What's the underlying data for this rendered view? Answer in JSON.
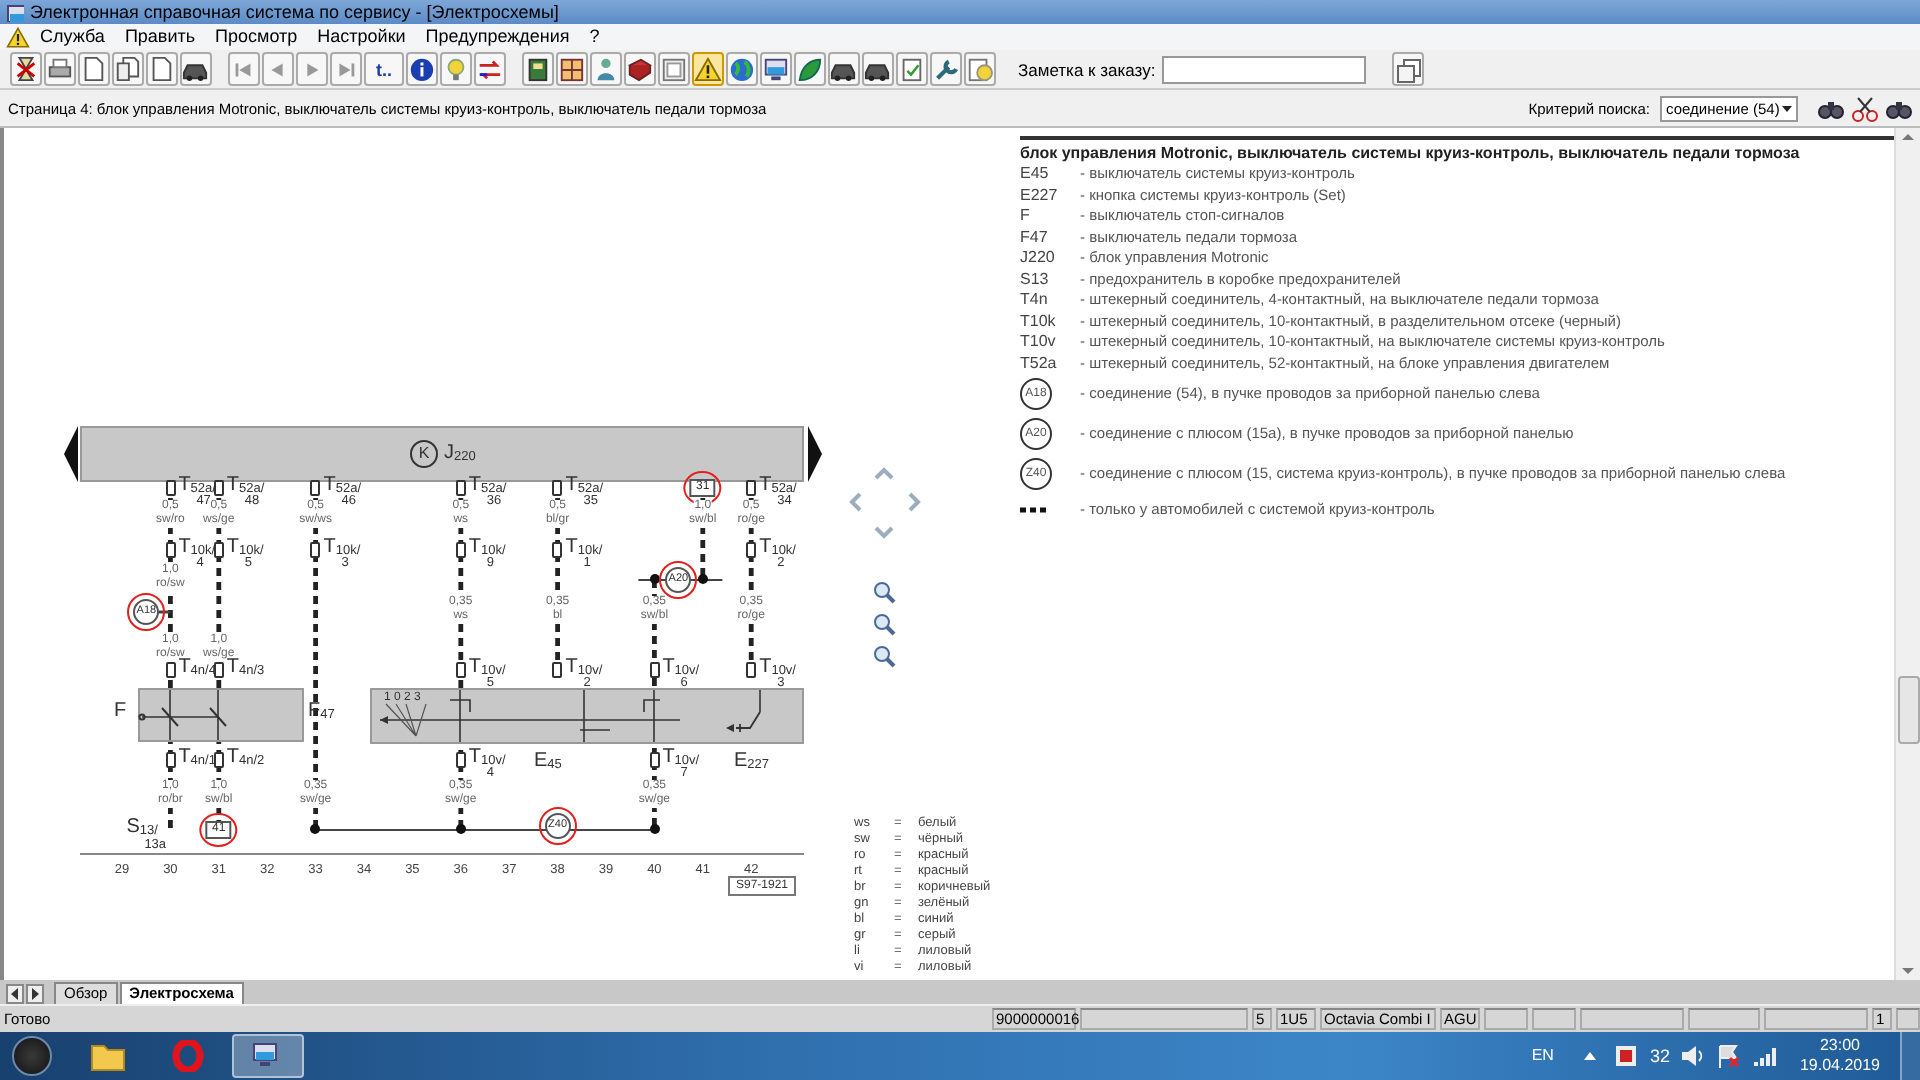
{
  "window": {
    "title": "Электронная справочная система по сервису - [Электросхемы]"
  },
  "menu": [
    "Служба",
    "Править",
    "Просмотр",
    "Настройки",
    "Предупреждения",
    "?"
  ],
  "toolbar": {
    "text_button": "t..",
    "note_label": "Заметка к заказу:"
  },
  "page_bar": {
    "title": "Страница 4: блок управления Motronic, выключатель системы круиз-контроль, выключатель педали тормоза",
    "search_label": "Критерий поиска:",
    "search_value": "соединение (54)"
  },
  "diagram": {
    "control_unit": {
      "symbol": "K",
      "label": "J$_{220}$"
    },
    "columns": [
      "29",
      "30",
      "31",
      "32",
      "33",
      "34",
      "35",
      "36",
      "37",
      "38",
      "39",
      "40",
      "41",
      "42"
    ],
    "drawing_number": "S97-1921",
    "wires": [
      {
        "items": [
          {
            "kind": "connector",
            "label": "T$_{52a/}$",
            "pin": "47"
          },
          {
            "kind": "gauge",
            "size": "0,5",
            "insulation": "sw/ro"
          },
          {
            "kind": "connector",
            "label": "T$_{10k/}$",
            "pin": "4"
          },
          {
            "kind": "gauge",
            "size": "1,0",
            "insulation": "ro/sw"
          },
          {
            "kind": "gauge",
            "size": "1,0",
            "insulation": "ro/sw"
          },
          {
            "kind": "connector",
            "label": "T$_{4n/4}$"
          },
          {
            "kind": "connector",
            "label": "T$_{4n/1}$"
          },
          {
            "kind": "gauge",
            "size": "1,0",
            "insulation": "ro/br"
          },
          {
            "kind": "fuse",
            "label": "S$_{13/}$",
            "pin": "13a"
          }
        ]
      },
      {
        "items": [
          {
            "kind": "connector",
            "label": "T$_{52a/}$",
            "pin": "48"
          },
          {
            "kind": "gauge",
            "size": "0,5",
            "insulation": "ws/ge"
          },
          {
            "kind": "connector",
            "label": "T$_{10k/}$",
            "pin": "5"
          },
          {
            "kind": "gauge",
            "size": "1,0",
            "insulation": "ws/ge"
          },
          {
            "kind": "connector",
            "label": "T$_{4n/3}$"
          },
          {
            "kind": "connector",
            "label": "T$_{4n/2}$"
          },
          {
            "kind": "gauge",
            "size": "1,0",
            "insulation": "sw/bl"
          },
          {
            "kind": "terminal",
            "label": "41",
            "highlighted": true
          }
        ]
      },
      {
        "items": [
          {
            "kind": "connector",
            "label": "T$_{52a/}$",
            "pin": "46"
          },
          {
            "kind": "gauge",
            "size": "0,5",
            "insulation": "sw/ws"
          },
          {
            "kind": "connector",
            "label": "T$_{10k/}$",
            "pin": "3"
          },
          {
            "kind": "gauge",
            "size": "0,35",
            "insulation": "sw/ge"
          },
          {
            "kind": "node"
          }
        ]
      },
      {
        "items": [
          {
            "kind": "connector",
            "label": "T$_{52a/}$",
            "pin": "36"
          },
          {
            "kind": "gauge",
            "size": "0,5",
            "insulation": "ws"
          },
          {
            "kind": "connector",
            "label": "T$_{10k/}$",
            "pin": "9"
          },
          {
            "kind": "gauge",
            "size": "0,35",
            "insulation": "ws"
          },
          {
            "kind": "connector",
            "label": "T$_{10v/}$",
            "pin": "5"
          },
          {
            "kind": "connector",
            "label": "T$_{10v/}$",
            "pin": "4"
          },
          {
            "kind": "gauge",
            "size": "0,35",
            "insulation": "sw/ge"
          },
          {
            "kind": "node"
          }
        ]
      },
      {
        "items": [
          {
            "kind": "connector",
            "label": "T$_{52a/}$",
            "pin": "35"
          },
          {
            "kind": "gauge",
            "size": "0,5",
            "insulation": "bl/gr"
          },
          {
            "kind": "connector",
            "label": "T$_{10k/}$",
            "pin": "1"
          },
          {
            "kind": "gauge",
            "size": "0,35",
            "insulation": "bl"
          },
          {
            "kind": "connector",
            "label": "T$_{10v/}$",
            "pin": "2"
          }
        ]
      },
      {
        "items": [
          {
            "kind": "node"
          },
          {
            "kind": "gauge",
            "size": "0,35",
            "insulation": "sw/bl"
          },
          {
            "kind": "connector",
            "label": "T$_{10v/}$",
            "pin": "6"
          },
          {
            "kind": "connector",
            "label": "T$_{10v/}$",
            "pin": "7"
          },
          {
            "kind": "gauge",
            "size": "0,35",
            "insulation": "sw/ge"
          },
          {
            "kind": "node"
          }
        ]
      },
      {
        "items": [
          {
            "kind": "terminal",
            "label": "31",
            "highlighted": true
          },
          {
            "kind": "gauge",
            "size": "1,0",
            "insulation": "sw/bl"
          },
          {
            "kind": "node"
          }
        ]
      },
      {
        "items": [
          {
            "kind": "connector",
            "label": "T$_{52a/}$",
            "pin": "34"
          },
          {
            "kind": "gauge",
            "size": "0,5",
            "insulation": "ro/ge"
          },
          {
            "kind": "connector",
            "label": "T$_{10k/}$",
            "pin": "2"
          },
          {
            "kind": "gauge",
            "size": "0,35",
            "insulation": "ro/ge"
          },
          {
            "kind": "connector",
            "label": "T$_{10v/}$",
            "pin": "3"
          }
        ]
      }
    ],
    "splices": [
      {
        "label": "A18",
        "highlighted": true
      },
      {
        "label": "A20",
        "highlighted": true
      },
      {
        "label": "Z40",
        "highlighted": true
      }
    ],
    "boxes": [
      {
        "labels": [
          "F",
          "F$_{47}$"
        ]
      },
      {
        "labels": [
          "E$_{45}$",
          "E$_{227}$"
        ],
        "positions": "1 0 2 3"
      }
    ]
  },
  "color_legend": [
    {
      "code": "ws",
      "sign": "=",
      "name": "белый"
    },
    {
      "code": "sw",
      "sign": "=",
      "name": "чёрный"
    },
    {
      "code": "ro",
      "sign": "=",
      "name": "красный"
    },
    {
      "code": "rt",
      "sign": "=",
      "name": "красный"
    },
    {
      "code": "br",
      "sign": "=",
      "name": "коричневый"
    },
    {
      "code": "gn",
      "sign": "=",
      "name": "зелёный"
    },
    {
      "code": "bl",
      "sign": "=",
      "name": "синий"
    },
    {
      "code": "gr",
      "sign": "=",
      "name": "серый"
    },
    {
      "code": "li",
      "sign": "=",
      "name": "лиловый"
    },
    {
      "code": "vi",
      "sign": "=",
      "name": "лиловый"
    }
  ],
  "legend": {
    "title": "блок управления Motronic, выключатель системы круиз-контроль, выключатель педали тормоза",
    "entries": [
      {
        "kind": "code",
        "code": "E45",
        "text": "- выключатель системы круиз-контроль"
      },
      {
        "kind": "code",
        "code": "E227",
        "text": "- кнопка системы круиз-контроль (Set)"
      },
      {
        "kind": "code",
        "code": "F",
        "text": "- выключатель стоп-сигналов"
      },
      {
        "kind": "code",
        "code": "F47",
        "text": "- выключатель педали тормоза"
      },
      {
        "kind": "code",
        "code": "J220",
        "text": "- блок управления Motronic"
      },
      {
        "kind": "code",
        "code": "S13",
        "text": "- предохранитель в коробке предохранителей"
      },
      {
        "kind": "code",
        "code": "T4n",
        "text": "- штекерный соединитель, 4-контактный, на выключателе педали тормоза"
      },
      {
        "kind": "code",
        "code": "T10k",
        "text": "- штекерный соединитель, 10-контактный, в разделительном отсеке (черный)"
      },
      {
        "kind": "code",
        "code": "T10v",
        "text": "- штекерный соединитель, 10-контактный, на выключателе системы круиз-контроль"
      },
      {
        "kind": "code",
        "code": "T52a",
        "text": "- штекерный соединитель, 52-контактный, на блоке управления двигателем"
      },
      {
        "kind": "splice",
        "code": "A18",
        "text": "- соединение (54), в пучке проводов за приборной панелью слева"
      },
      {
        "kind": "splice",
        "code": "A20",
        "text": "- соединение с плюсом (15а), в пучке проводов за приборной панелью"
      },
      {
        "kind": "splice",
        "code": "Z40",
        "text": "- соединение с плюсом (15, система круиз-контроль), в пучке проводов за приборной панелью слева"
      },
      {
        "kind": "dashed",
        "text": "- только у автомобилей с системой круиз-контроль"
      }
    ]
  },
  "tabs": [
    {
      "label": "Обзор",
      "selected": false
    },
    {
      "label": "Электросхема",
      "selected": true
    }
  ],
  "status_bar": {
    "message": "Готово",
    "fields": [
      "9000000016",
      "5",
      "1U5",
      "Octavia Combi I",
      "AGU",
      "1"
    ]
  },
  "taskbar": {
    "language": "EN",
    "tray_count": "32",
    "time": "23:00",
    "date": "19.04.2019"
  }
}
